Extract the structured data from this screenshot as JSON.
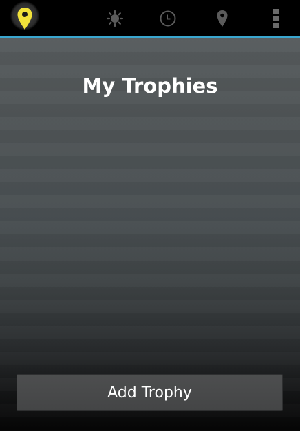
{
  "action_bar": {
    "icons": [
      "map-pin-home-icon",
      "brightness-icon",
      "clock-icon",
      "location-pin-icon",
      "overflow-menu-icon"
    ],
    "accent_color": "#3aa6cf",
    "home_icon_color": "#f1e23a"
  },
  "main": {
    "title": "My Trophies",
    "add_button_label": "Add Trophy"
  }
}
